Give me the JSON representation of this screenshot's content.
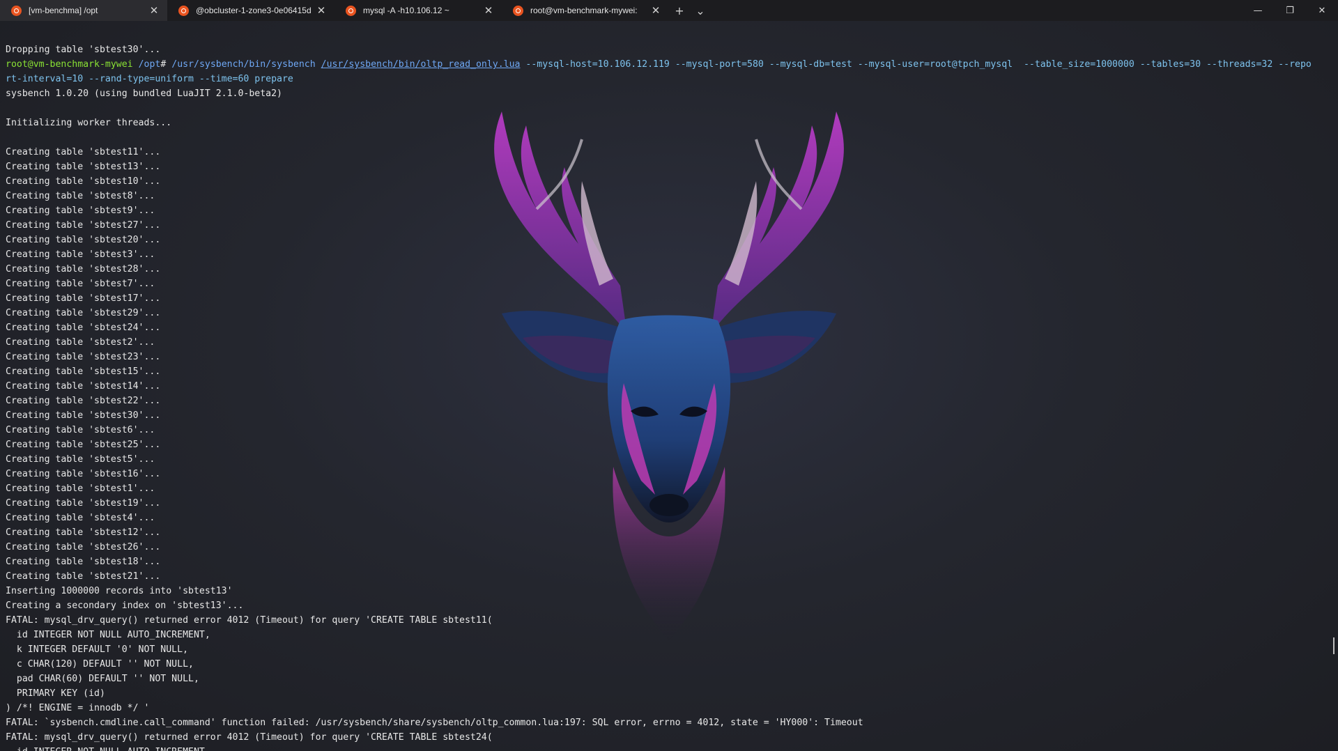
{
  "tabs": [
    {
      "title": "[vm-benchma] /opt",
      "active": true
    },
    {
      "title": "@obcluster-1-zone3-0e06415d",
      "active": false
    },
    {
      "title": "mysql -A -h10.106.12 ~",
      "active": false
    },
    {
      "title": "root@vm-benchmark-mywei: ",
      "active": false
    }
  ],
  "tab_actions": {
    "new_tab": "+",
    "dropdown": "⌄"
  },
  "window_controls": {
    "minimize": "—",
    "maximize": "❐",
    "close": "✕"
  },
  "terminal": {
    "line_dropping": "Dropping table 'sbtest30'...",
    "prompt": {
      "user_host": "root@vm-benchmark-mywei",
      "path": "/opt",
      "symbol": "#",
      "command": "/usr/sysbench/bin/sysbench",
      "script": "/usr/sysbench/bin/oltp_read_only.lua",
      "args_1": "--mysql-host=10.106.12.119 --mysql-port=580 --mysql-db=test --mysql-user=root@tpch_mysql  --table_size=1000000 --tables=30 --threads=32 --repo",
      "args_2": "rt-interval=10 --rand-type=uniform --time=60 prepare"
    },
    "version": "sysbench 1.0.20 (using bundled LuaJIT 2.1.0-beta2)",
    "blank_1": "",
    "init": "Initializing worker threads...",
    "blank_2": "",
    "creating": [
      "Creating table 'sbtest11'...",
      "Creating table 'sbtest13'...",
      "Creating table 'sbtest10'...",
      "Creating table 'sbtest8'...",
      "Creating table 'sbtest9'...",
      "Creating table 'sbtest27'...",
      "Creating table 'sbtest20'...",
      "Creating table 'sbtest3'...",
      "Creating table 'sbtest28'...",
      "Creating table 'sbtest7'...",
      "Creating table 'sbtest17'...",
      "Creating table 'sbtest29'...",
      "Creating table 'sbtest24'...",
      "Creating table 'sbtest2'...",
      "Creating table 'sbtest23'...",
      "Creating table 'sbtest15'...",
      "Creating table 'sbtest14'...",
      "Creating table 'sbtest22'...",
      "Creating table 'sbtest30'...",
      "Creating table 'sbtest6'...",
      "Creating table 'sbtest25'...",
      "Creating table 'sbtest5'...",
      "Creating table 'sbtest16'...",
      "Creating table 'sbtest1'...",
      "Creating table 'sbtest19'...",
      "Creating table 'sbtest4'...",
      "Creating table 'sbtest12'...",
      "Creating table 'sbtest26'...",
      "Creating table 'sbtest18'...",
      "Creating table 'sbtest21'..."
    ],
    "tail": [
      "Inserting 1000000 records into 'sbtest13'",
      "Creating a secondary index on 'sbtest13'...",
      "FATAL: mysql_drv_query() returned error 4012 (Timeout) for query 'CREATE TABLE sbtest11(",
      "  id INTEGER NOT NULL AUTO_INCREMENT,",
      "  k INTEGER DEFAULT '0' NOT NULL,",
      "  c CHAR(120) DEFAULT '' NOT NULL,",
      "  pad CHAR(60) DEFAULT '' NOT NULL,",
      "  PRIMARY KEY (id)",
      ") /*! ENGINE = innodb */ '",
      "FATAL: `sysbench.cmdline.call_command' function failed: /usr/sysbench/share/sysbench/oltp_common.lua:197: SQL error, errno = 4012, state = 'HY000': Timeout",
      "FATAL: mysql_drv_query() returned error 4012 (Timeout) for query 'CREATE TABLE sbtest24(",
      "  id INTEGER NOT NULL AUTO_INCREMENT,"
    ]
  },
  "colors": {
    "user_host": "#8ae234",
    "path": "#6fa8f5",
    "command": "#6fa8f5",
    "args": "#7ec3ee",
    "background": "#1f1f23",
    "tab_active": "#2c2c30",
    "ubuntu_icon": "#e95420"
  },
  "icons": {
    "tab": "ubuntu-icon",
    "close": "close-icon",
    "new_tab": "plus-icon",
    "dropdown": "chevron-down-icon",
    "background_art": "deer-head-illustration"
  }
}
